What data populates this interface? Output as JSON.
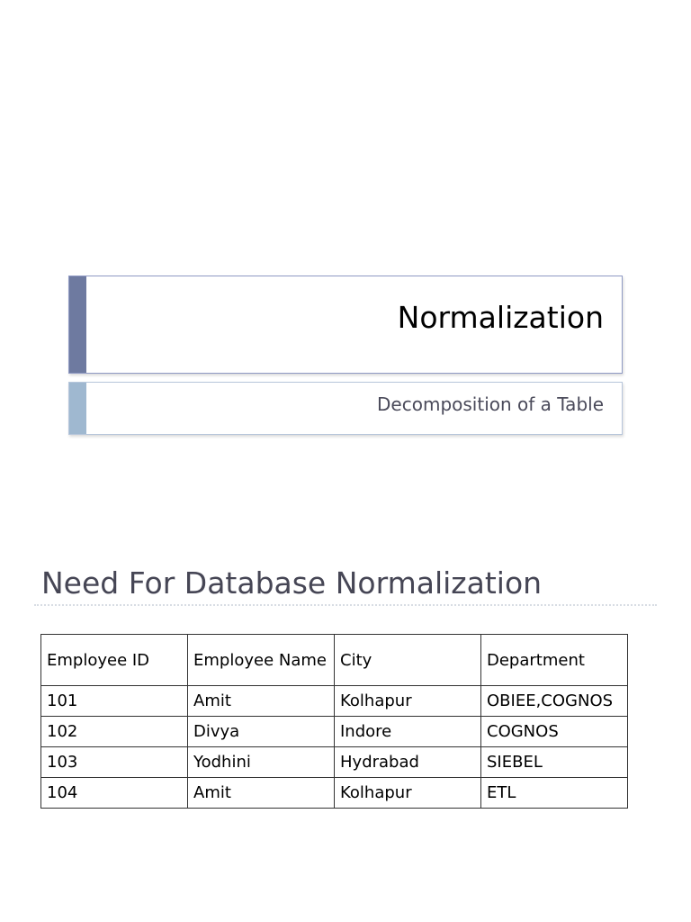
{
  "title_slide": {
    "title": "Normalization",
    "subtitle": "Decomposition of a Table"
  },
  "slide": {
    "heading": "Need For Database Normalization"
  },
  "table": {
    "headers": [
      "Employee ID",
      "Employee Name",
      "City",
      "Department"
    ],
    "rows": [
      [
        "101",
        "Amit",
        "Kolhapur",
        "OBIEE,COGNOS"
      ],
      [
        "102",
        "Divya",
        "Indore",
        "COGNOS"
      ],
      [
        "103",
        "Yodhini",
        "Hydrabad",
        "SIEBEL"
      ],
      [
        "104",
        "Amit",
        "Kolhapur",
        "ETL"
      ]
    ]
  }
}
